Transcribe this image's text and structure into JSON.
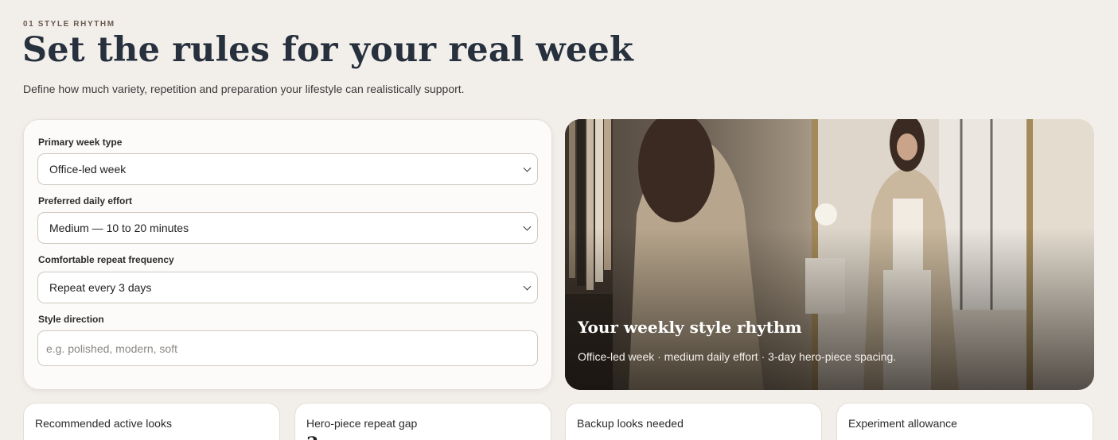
{
  "header": {
    "eyebrow": "01 STYLE RHYTHM",
    "title": "Set the rules for your real week",
    "subtitle": "Define how much variety, repetition and preparation your lifestyle can realistically support."
  },
  "form": {
    "week_type": {
      "label": "Primary week type",
      "value": "Office-led week"
    },
    "daily_effort": {
      "label": "Preferred daily effort",
      "value": "Medium — 10 to 20 minutes"
    },
    "repeat_frequency": {
      "label": "Comfortable repeat frequency",
      "value": "Repeat every 3 days"
    },
    "style_direction": {
      "label": "Style direction",
      "value": "",
      "placeholder": "e.g. polished, modern, soft"
    }
  },
  "hero": {
    "title": "Your weekly style rhythm",
    "caption": "Office-led week · medium daily effort · 3-day hero-piece spacing."
  },
  "stats": [
    {
      "label": "Recommended active looks"
    },
    {
      "label": "Hero-piece repeat gap",
      "value": "3"
    },
    {
      "label": "Backup looks needed"
    },
    {
      "label": "Experiment allowance"
    }
  ],
  "colors": {
    "background": "#f2efeb",
    "title": "#27303d",
    "card": "#fdfbf9"
  }
}
